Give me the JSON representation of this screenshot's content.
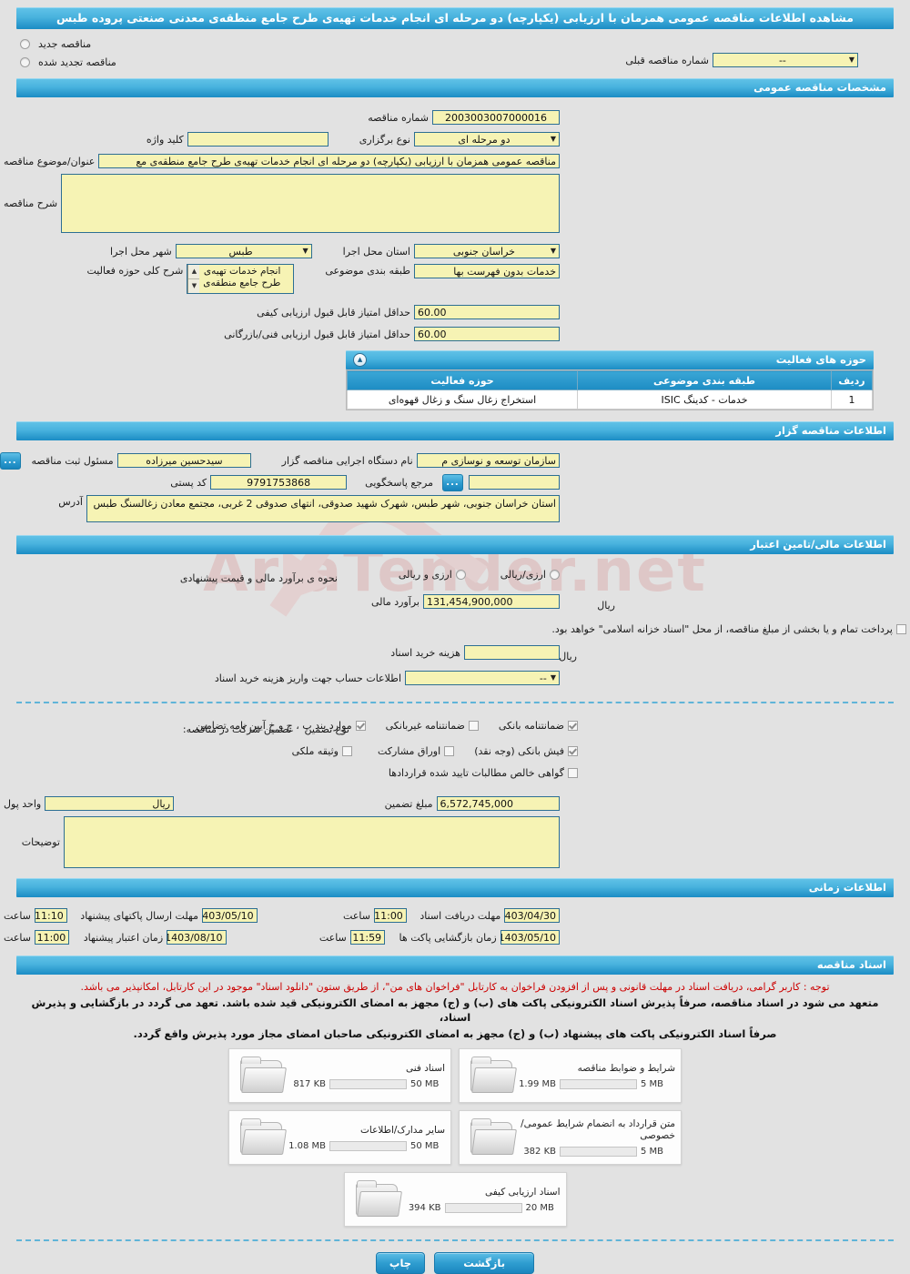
{
  "page_title": "مشاهده اطلاعات مناقصه عمومی همزمان با ارزیابی (یکپارچه) دو مرحله ای انجام خدمات تهیه‌ی طرح جامع منطقه‌ی معدنی صنعتی پروده طبس",
  "top_options": {
    "new_tender": "مناقصه جدید",
    "renewed_tender": "مناقصه تجدید شده",
    "prev_number_label": "شماره مناقصه قبلی",
    "prev_number_value": "--"
  },
  "general": {
    "section_title": "مشخصات مناقصه عمومی",
    "tender_no_label": "شماره مناقصه",
    "tender_no_value": "2003003007000016",
    "holding_type_label": "نوع برگزاری",
    "holding_type_value": "دو مرحله ای",
    "keyword_label": "کلید واژه",
    "keyword_value": "",
    "subject_label": "عنوان/موضوع مناقصه",
    "subject_value": "مناقصه عمومی همزمان با ارزیابی (یکپارچه) دو مرحله ای انجام خدمات تهیه‌ی طرح جامع منطقه‌ی مع",
    "description_label": "شرح مناقصه",
    "description_value": "",
    "province_label": "استان محل اجرا",
    "province_value": "خراسان جنوبی",
    "city_label": "شهر محل اجرا",
    "city_value": "طبس",
    "classification_label": "طبقه بندی موضوعی",
    "classification_value": "خدمات بدون فهرست بها",
    "activity_desc_label": "شرح کلی حوزه فعالیت",
    "activity_desc_value": "انجام خدمات تهیه‌ی طرح جامع منطقه‌ی معدنی",
    "min_quality_label": "حداقل امتیاز قابل قبول ارزیابی کیفی",
    "min_quality_value": "60.00",
    "min_tech_label": "حداقل امتیاز قابل قبول ارزیابی فنی/بازرگانی",
    "min_tech_value": "60.00"
  },
  "activity_table": {
    "section_title": "حوزه های فعالیت",
    "columns": [
      "ردیف",
      "طبقه بندی موضوعی",
      "حوزه فعالیت"
    ],
    "rows": [
      [
        "1",
        "خدمات - کدینگ ISIC",
        "استخراج زغال سنگ و  زغال قهوه‌ای"
      ]
    ]
  },
  "organizer": {
    "section_title": "اطلاعات مناقصه گزار",
    "agency_label": "نام دستگاه اجرایی مناقصه گزار",
    "agency_value": "سازمان توسعه و نوسازی م",
    "registrar_label": "مسئول ثبت مناقصه",
    "registrar_value": "سیدحسین میرزاده",
    "contact_label": "مرجع پاسخگویی",
    "contact_value": "",
    "postal_label": "کد پستی",
    "postal_value": "9791753868",
    "address_label": "آدرس",
    "address_value": "استان خراسان جنوبی، شهر طبس، شهرک شهید صدوقی، انتهای صدوقی 2 غربی، مجتمع معادن زغالسنگ طبس",
    "dots_label": "..."
  },
  "financial": {
    "section_title": "اطلاعات مالی/تامین اعتبار",
    "estimate_mode_label": "نحوه ی برآورد مالی و قیمت پیشنهادی",
    "option_currency_rial": "ارزی/ریالی",
    "option_currency_and_rial": "ارزی و ریالی",
    "estimate_label": "برآورد مالی",
    "estimate_value": "131,454,900,000",
    "estimate_currency": "ریال",
    "treasury_note": "پرداخت تمام و یا بخشی از مبلغ مناقصه، از محل \"اسناد خزانه اسلامی\" خواهد بود.",
    "doc_cost_label": "هزینه خرید اسناد",
    "doc_cost_value": "",
    "doc_cost_currency": "ریال",
    "account_label": "اطلاعات حساب جهت واریز هزینه خرید اسناد",
    "account_value": "--"
  },
  "guarantee": {
    "participation_label": "تضمین شرکت در مناقصه:",
    "type_label": "نوع تضمین",
    "options": [
      {
        "label": "ضمانتنامه بانکی",
        "checked": true
      },
      {
        "label": "ضمانتنامه غیربانکی",
        "checked": false
      },
      {
        "label": "موارد بند پ ، ج و خ آیین نامه تضامین",
        "checked": true
      },
      {
        "label": "فیش بانکی (وجه نقد)",
        "checked": true
      },
      {
        "label": "اوراق مشارکت",
        "checked": false
      },
      {
        "label": "وثیقه ملکی",
        "checked": false
      },
      {
        "label": "گواهی خالص مطالبات تایید شده قراردادها",
        "checked": false
      }
    ],
    "amount_label": "مبلغ تضمین",
    "amount_value": "6,572,745,000",
    "currency_label": "واحد پول",
    "currency_value": "ریال",
    "notes_label": "توضیحات",
    "notes_value": ""
  },
  "timing": {
    "section_title": "اطلاعات زمانی",
    "time_label": "ساعت",
    "rows": [
      {
        "label": "مهلت دریافت اسناد",
        "date": "1403/04/30",
        "time": "11:00"
      },
      {
        "label": "مهلت ارسال پاکتهای پیشنهاد",
        "date": "1403/05/10",
        "time": "11:10"
      },
      {
        "label": "زمان بازگشایی پاکت ها",
        "date": "1403/05/10",
        "time": "11:59"
      },
      {
        "label": "زمان اعتبار پیشنهاد",
        "date": "1403/08/10",
        "time": "11:00"
      }
    ]
  },
  "documents": {
    "section_title": "اسناد مناقصه",
    "notice_red": "توجه : کاربر گرامی، دریافت اسناد در مهلت قانونی و پس از افزودن فراخوان به کارتابل \"فراخوان های من\"، از طریق ستون \"دانلود اسناد\" موجود در این کارتابل، امکانپذیر می باشد.",
    "notice_bold_1": "متعهد می شود در اسناد مناقصه، صرفاً پذیرش اسناد الکترونیکی پاکت های (ب) و (ج) مجهز به امضای الکترونیکی قید شده باشد. تعهد می گردد در بازگشایی و پذیرش اسناد،",
    "notice_bold_2": "صرفاً اسناد الکترونیکی پاکت های پیشنهاد (ب) و (ج) مجهز به امضای الکترونیکی صاحبان امضای مجاز مورد پذیرش واقع گردد.",
    "files": [
      {
        "title": "شرایط و ضوابط مناقصه",
        "used": "1.99 MB",
        "max": "5 MB",
        "percent": 40
      },
      {
        "title": "اسناد فنی",
        "used": "817 KB",
        "max": "50 MB",
        "percent": 2
      },
      {
        "title": "متن قرارداد به انضمام شرایط عمومی/خصوصی",
        "used": "382 KB",
        "max": "5 MB",
        "percent": 8
      },
      {
        "title": "سایر مدارک/اطلاعات",
        "used": "1.08 MB",
        "max": "50 MB",
        "percent": 3
      },
      {
        "title": "اسناد ارزیابی کیفی",
        "used": "394 KB",
        "max": "20 MB",
        "percent": 2
      }
    ]
  },
  "footer": {
    "print_label": "چاپ",
    "back_label": "بازگشت"
  },
  "watermark": {
    "text": "AriaTender.net"
  },
  "colors": {
    "header_blue": "#1d8cc3",
    "field_yellow": "#f6f3b4",
    "field_border": "#2d6f93",
    "page_bg": "#e2e2e2",
    "notice_red": "#cc0000",
    "meter_green": "#71c62f"
  }
}
